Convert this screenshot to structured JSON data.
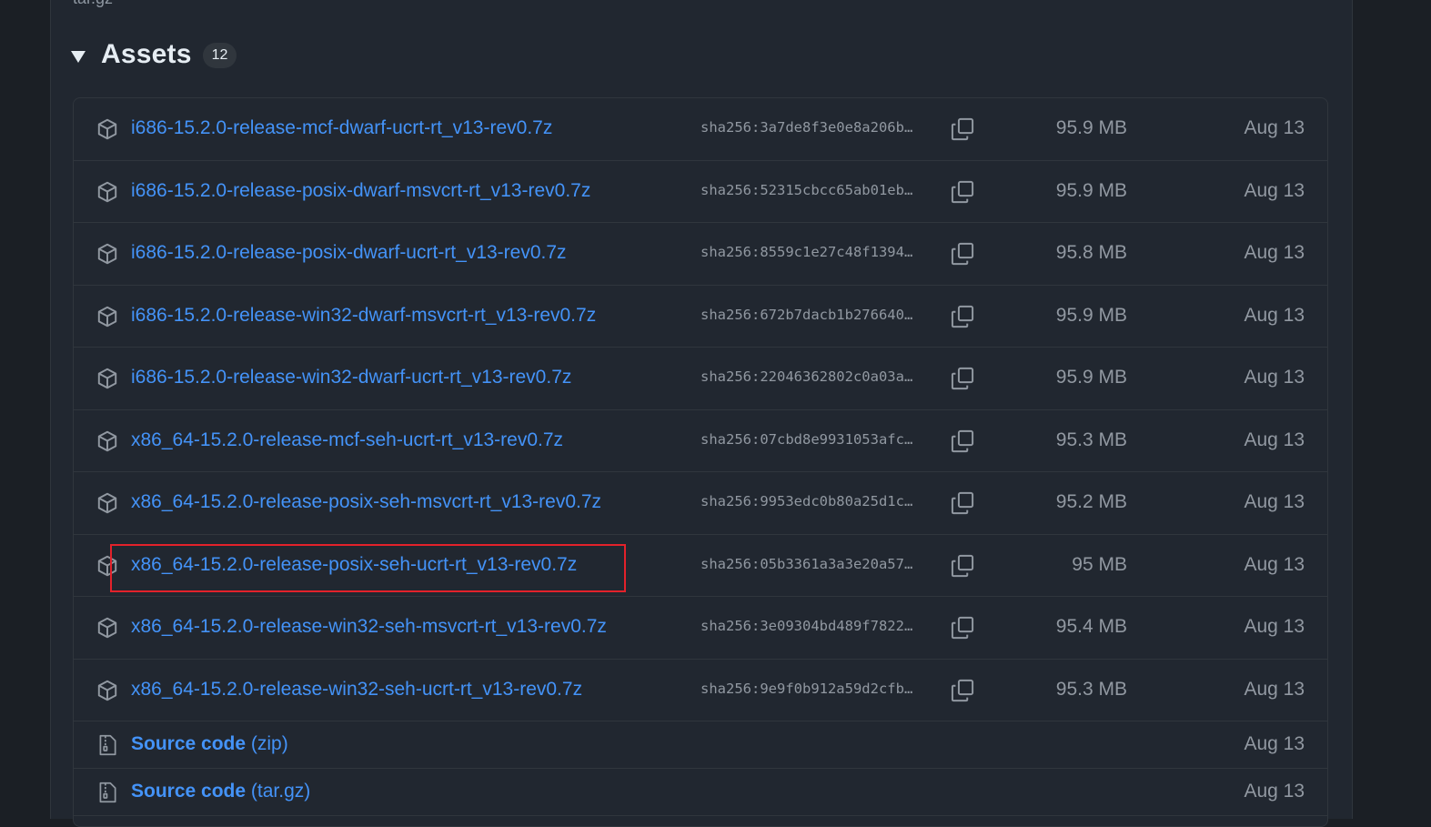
{
  "assets": {
    "title": "Assets",
    "count": "12",
    "top_cut_text": "tar.gz",
    "items": [
      {
        "name": "i686-15.2.0-release-mcf-dwarf-ucrt-rt_v13-rev0.7z",
        "sha": "sha256:3a7de8f3e0e8a206b…",
        "size": "95.9 MB",
        "date": "Aug 13"
      },
      {
        "name": "i686-15.2.0-release-posix-dwarf-msvcrt-rt_v13-rev0.7z",
        "sha": "sha256:52315cbcc65ab01eb…",
        "size": "95.9 MB",
        "date": "Aug 13"
      },
      {
        "name": "i686-15.2.0-release-posix-dwarf-ucrt-rt_v13-rev0.7z",
        "sha": "sha256:8559c1e27c48f1394…",
        "size": "95.8 MB",
        "date": "Aug 13"
      },
      {
        "name": "i686-15.2.0-release-win32-dwarf-msvcrt-rt_v13-rev0.7z",
        "sha": "sha256:672b7dacb1b276640…",
        "size": "95.9 MB",
        "date": "Aug 13"
      },
      {
        "name": "i686-15.2.0-release-win32-dwarf-ucrt-rt_v13-rev0.7z",
        "sha": "sha256:22046362802c0a03a…",
        "size": "95.9 MB",
        "date": "Aug 13"
      },
      {
        "name": "x86_64-15.2.0-release-mcf-seh-ucrt-rt_v13-rev0.7z",
        "sha": "sha256:07cbd8e9931053afc…",
        "size": "95.3 MB",
        "date": "Aug 13"
      },
      {
        "name": "x86_64-15.2.0-release-posix-seh-msvcrt-rt_v13-rev0.7z",
        "sha": "sha256:9953edc0b80a25d1c…",
        "size": "95.2 MB",
        "date": "Aug 13"
      },
      {
        "name": "x86_64-15.2.0-release-posix-seh-ucrt-rt_v13-rev0.7z",
        "sha": "sha256:05b3361a3a3e20a57…",
        "size": "95 MB",
        "date": "Aug 13"
      },
      {
        "name": "x86_64-15.2.0-release-win32-seh-msvcrt-rt_v13-rev0.7z",
        "sha": "sha256:3e09304bd489f7822…",
        "size": "95.4 MB",
        "date": "Aug 13"
      },
      {
        "name": "x86_64-15.2.0-release-win32-seh-ucrt-rt_v13-rev0.7z",
        "sha": "sha256:9e9f0b912a59d2cfb…",
        "size": "95.3 MB",
        "date": "Aug 13"
      }
    ],
    "source": [
      {
        "label": "Source code",
        "suffix": "(zip)",
        "date": "Aug 13"
      },
      {
        "label": "Source code",
        "suffix": "(tar.gz)",
        "date": "Aug 13"
      }
    ]
  },
  "colors": {
    "link": "#4493f8",
    "muted": "#9198a1",
    "highlight": "#e3222b"
  },
  "icons": {
    "asset": "package-icon",
    "copy": "copy-icon",
    "source": "file-zip-icon"
  }
}
